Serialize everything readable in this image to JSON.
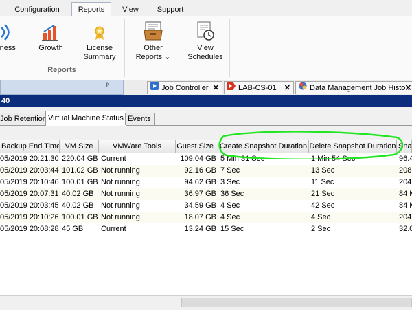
{
  "ribbon": {
    "tabs": [
      "Configuration",
      "Reports",
      "View",
      "Support"
    ],
    "active_tab": "Reports",
    "buttons": {
      "business": "iness",
      "growth": "Growth",
      "license_1": "License",
      "license_2": "Summary",
      "other_1": "Other",
      "other_2": "Reports",
      "view_1": "View",
      "view_2": "Schedules"
    },
    "dropdown_glyph": "⌄",
    "group_label": "Reports"
  },
  "doc_tabs": {
    "pin_glyph": "ᵖ",
    "items": [
      {
        "label": "Job Controller",
        "close": "✕"
      },
      {
        "label": "LAB-CS-01",
        "close": "✕"
      },
      {
        "label": "Data Management Job Histo...",
        "close": "✕"
      }
    ]
  },
  "title_bar": "40",
  "sub_tabs": [
    "Job Retention",
    "Virtual Machine Status",
    "Events"
  ],
  "active_sub_tab": "Virtual Machine Status",
  "grid": {
    "columns": [
      "Backup End Time",
      "VM Size",
      "VMWare Tools",
      "Guest Size",
      "Create Snapshot Duration",
      "Delete Snapshot Duration",
      "Sna"
    ],
    "rows": [
      [
        "05/2019 20:21:30",
        "220.04 GB",
        "Current",
        "109.04 GB",
        "5 Min 31 Sec",
        "1 Min 54 Sec",
        "96.4"
      ],
      [
        "05/2019 20:03:44",
        "101.02 GB",
        "Not running",
        "92.16 GB",
        "7 Sec",
        "13 Sec",
        "208"
      ],
      [
        "05/2019 20:10:46",
        "100.01 GB",
        "Not running",
        "94.62 GB",
        "3 Sec",
        "11 Sec",
        "204"
      ],
      [
        "05/2019 20:07:31",
        "40.02 GB",
        "Not running",
        "36.97 GB",
        "36 Sec",
        "21 Sec",
        "84 K"
      ],
      [
        "05/2019 20:03:45",
        "40.02 GB",
        "Not running",
        "34.59 GB",
        "4 Sec",
        "42 Sec",
        "84 K"
      ],
      [
        "05/2019 20:10:26",
        "100.01 GB",
        "Not running",
        "18.07 GB",
        "4 Sec",
        "4 Sec",
        "204"
      ],
      [
        "05/2019 20:08:28",
        "45 GB",
        "Current",
        "13.24 GB",
        "15 Sec",
        "2 Sec",
        "32.0"
      ]
    ]
  },
  "colors": {
    "title_bar": "#0c2c7c",
    "annotation": "#22e622",
    "pane_title": "#cfdcee"
  },
  "icons": [
    "wireless-icon",
    "growth-chart-icon",
    "license-badge-icon",
    "other-reports-icon",
    "view-schedules-icon",
    "pin-icon",
    "job-controller-icon",
    "client-icon",
    "data-management-icon"
  ]
}
